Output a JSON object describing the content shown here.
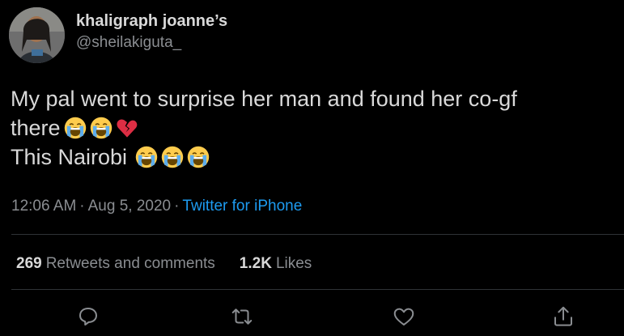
{
  "author": {
    "display_name": "khaligraph joanne’s",
    "handle": "@sheilakiguta_"
  },
  "tweet": {
    "line1": "My pal went to surprise her man and found her co-gf",
    "line2_text": "there",
    "line2_emojis": [
      "loudly-crying-face-emoji",
      "loudly-crying-face-emoji",
      "broken-heart-emoji"
    ],
    "line3_text": "This Nairobi",
    "line3_emojis": [
      "loudly-crying-face-emoji",
      "loudly-crying-face-emoji",
      "loudly-crying-face-emoji"
    ]
  },
  "meta": {
    "time": "12:06 AM",
    "separator": "·",
    "date": "Aug 5, 2020",
    "source": "Twitter for iPhone"
  },
  "stats": {
    "retweets_count": "269",
    "retweets_label": "Retweets and comments",
    "likes_count": "1.2K",
    "likes_label": "Likes"
  },
  "actions": [
    "reply-icon",
    "retweet-icon",
    "like-icon",
    "share-icon"
  ],
  "colors": {
    "background": "#000000",
    "text": "#d9d9d9",
    "secondary_text": "#8a8d91",
    "link": "#1d9bf0",
    "divider": "#2f3336"
  }
}
